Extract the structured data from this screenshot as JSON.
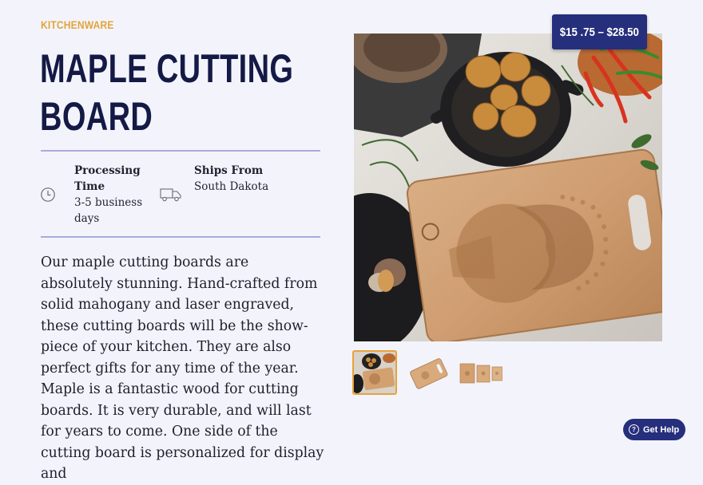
{
  "product": {
    "category": "KITCHENWARE",
    "title": "MAPLE CUTTING BOARD",
    "price_range": "$15 .75 – $28.50",
    "processing_label": "Processing Time",
    "processing_value": "3-5 business days",
    "ships_label": "Ships From",
    "ships_value": "South Dakota",
    "description": "Our maple cutting boards are absolutely stunning. Hand-crafted from solid mahogany and laser engraved, these cutting boards will be the show-piece of your kitchen. They are also perfect gifts for any time of the year.  Maple is a fantastic wood for cutting boards. It is very durable, and will last for years to come. One side of the cutting board is personalized for display and"
  },
  "gallery": {
    "thumbnails": [
      "table-scene",
      "single-board",
      "three-boards"
    ],
    "active_index": 0
  },
  "help": {
    "label": "Get Help"
  },
  "colors": {
    "accent": "#e3a43a",
    "navy": "#262f7c",
    "title": "#141a45",
    "background": "#f3f4fb"
  },
  "icons": [
    "clock-icon",
    "truck-icon",
    "question-icon"
  ]
}
